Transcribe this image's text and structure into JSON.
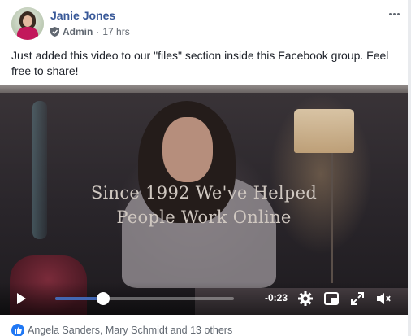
{
  "post": {
    "author": "Janie Jones",
    "role": "Admin",
    "time": "17 hrs",
    "text": "Just added this video to our \"files\" section inside this Facebook group. Feel free to share!"
  },
  "video": {
    "overlay_line1": "Since 1992 We've Helped",
    "overlay_line2": "People Work Online",
    "remaining_time": "-0:23",
    "progress": 0.27
  },
  "reactions": {
    "summary": "Angela Sanders, Mary Schmidt and 13 others"
  },
  "icons": {
    "admin": "shield-icon",
    "more": "more-options-icon",
    "play": "play-icon",
    "settings": "gear-icon",
    "pip": "picture-in-picture-icon",
    "fullscreen": "fullscreen-icon",
    "volume": "volume-icon",
    "like": "like-icon"
  },
  "colors": {
    "author": "#385898",
    "progress": "#4267b2",
    "like": "#2078f4"
  }
}
